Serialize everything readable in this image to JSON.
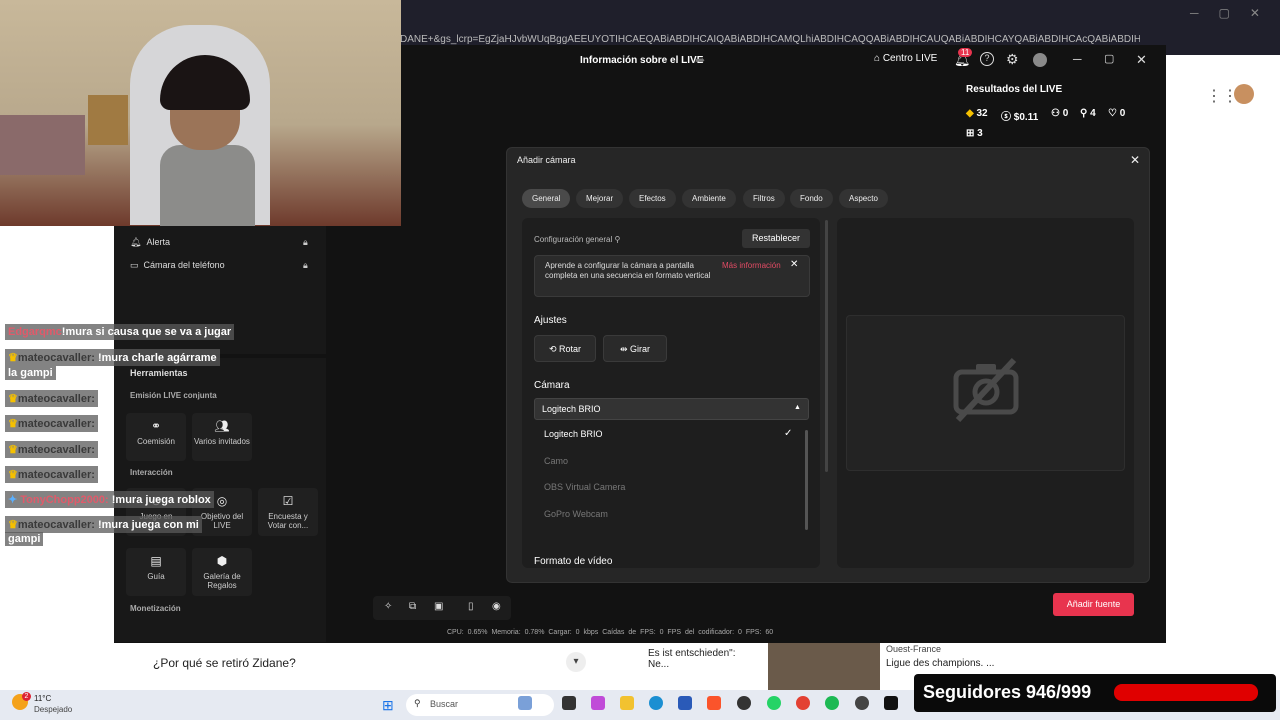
{
  "browser": {
    "url": "DANE+&gs_lcrp=EgZjaHJvbWUqBggAEEUYOTIHCAEQABiABDIHCAIQABiABDIHCAMQLhiABDIHCAQQABiABDIHCAUQABiABDIHCAYQABiABDIHCAcQABiABDIHCA...",
    "search_question": "¿Por qué se retiró Zidane?",
    "news1_text": "Es ist entschieden\": Ne...",
    "news2_source": "Ouest-France",
    "news2_text": "Ligue des champions. ..."
  },
  "studio": {
    "title": "Información sobre el LIVE",
    "centro_live": "Centro LIVE",
    "notif_count": "11",
    "results_title": "Resultados del LIVE",
    "stats": {
      "diamonds": "32",
      "money": "$0.11",
      "viewers": "0",
      "new_followers": "4",
      "likes": "0",
      "gifts": "3"
    },
    "sidebar": {
      "alerta": "Alerta",
      "camara_telefono": "Cámara del teléfono"
    },
    "tools": {
      "header": "Herramientas",
      "emision": "Emisión LIVE conjunta",
      "coemision": "Coemisión",
      "varios_invitados": "Varios invitados",
      "interaccion": "Interacción",
      "juego": "Juego en",
      "objetivo": "Objetivo del LIVE",
      "encuesta": "Encuesta y Votar con...",
      "guia": "Guía",
      "galeria": "Galería de Regalos",
      "monetizacion": "Monetización"
    },
    "statusbar": "CPU: 0.65%   Memoria: 0.78%   Cargar: 0 kbps   Caídas de FPS: 0   FPS del codificador: 0   FPS: 60"
  },
  "chat": [
    {
      "name": "Edgarqmc",
      "msg": "!mura si causa que se va a jugar",
      "crown": false
    },
    {
      "name": "mateocavaller:",
      "msg": "!mura charle agárrame",
      "msg2": "la gampi",
      "crown": true
    },
    {
      "name": "mateocavaller:",
      "msg": "",
      "crown": true
    },
    {
      "name": "mateocavaller:",
      "msg": "",
      "crown": true
    },
    {
      "name": "mateocavaller:",
      "msg": "",
      "crown": true
    },
    {
      "name": "mateocavaller:",
      "msg": "",
      "crown": true
    },
    {
      "name": "TonyChopp2000:",
      "msg": "!mura juega roblox",
      "crown": false
    },
    {
      "name": "mateocavaller:",
      "msg": "!mura juega con mi",
      "msg2": "gampi",
      "crown": true
    }
  ],
  "dialog": {
    "title": "Añadir cámara",
    "tabs": [
      "General",
      "Mejorar",
      "Efectos",
      "Ambiente",
      "Filtros",
      "Fondo",
      "Aspecto"
    ],
    "config_label": "Configuración general",
    "reset": "Restablecer",
    "tip": "Aprende a configurar la cámara a pantalla completa en una secuencia en formato vertical",
    "tip_link": "Más información",
    "ajustes": "Ajustes",
    "rotar": "Rotar",
    "girar": "Girar",
    "camara": "Cámara",
    "selected_camera": "Logitech BRIO",
    "options": [
      "Logitech BRIO",
      "Camo",
      "OBS Virtual Camera",
      "GoPro Webcam"
    ],
    "formato": "Formato de vídeo",
    "add_button": "Añadir fuente"
  },
  "taskbar": {
    "temp": "11°C",
    "weather": "Despejado",
    "weather_badge": "2",
    "search_placeholder": "Buscar"
  },
  "overlay": {
    "followers": "Seguidores 946/999"
  },
  "colors": {
    "accent": "#e8344e",
    "dialog_bg": "#262626",
    "studio_bg": "#121212"
  }
}
